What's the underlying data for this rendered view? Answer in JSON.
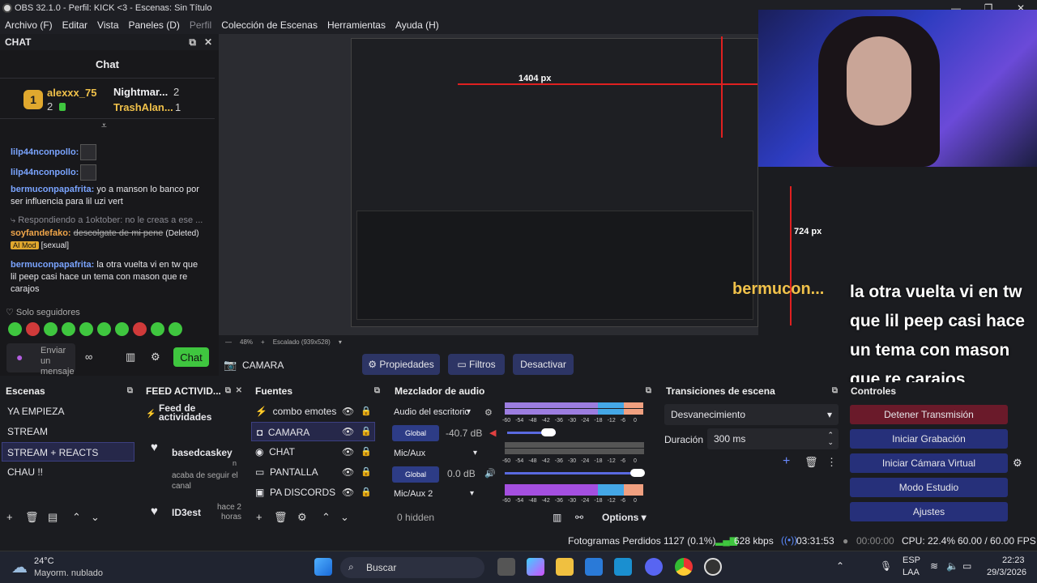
{
  "window": {
    "title": "OBS 32.1.0 - Perfil: KICK <3 - Escenas: Sin Título"
  },
  "menu": [
    "Archivo (F)",
    "Editar",
    "Vista",
    "Paneles (D)",
    "Perfil",
    "Colección de Escenas",
    "Herramientas",
    "Ayuda (H)"
  ],
  "chat": {
    "dock_title": "CHAT",
    "channel_title": "Chat",
    "leaders": [
      {
        "name": "alexxx_75",
        "rank": "1",
        "count": "2"
      },
      {
        "name": "Nightmar...",
        "count": "2"
      },
      {
        "name": "TrashAlan...",
        "count": "1"
      }
    ],
    "messages": [
      {
        "user": "lilp44nconpollo:",
        "text": ""
      },
      {
        "user": "lilp44nconpollo:",
        "text": ""
      },
      {
        "user": "bermuconpapafrita:",
        "text": "yo a manson lo banco por ser influencia para lil uzi vert"
      },
      {
        "reply": "Respondiendo a 1oktober: no le creas a ese ..."
      },
      {
        "user": "soyfandefako:",
        "text": "descolgate de mi pene",
        "deleted": "(Deleted)",
        "mod": "AI Mod",
        "flag": "[sexual]"
      },
      {
        "user": "bermuconpapafrita:",
        "text": "la otra vuelta vi en tw que lil peep casi hace un tema con mason que re carajos"
      }
    ],
    "followers_only": "Solo seguidores",
    "input_placeholder": "Enviar un mensaje",
    "send_label": "Chat"
  },
  "preview": {
    "nested_px_label": "1404 px",
    "nested_px_label2": "724 px",
    "overlay_user": "bermucon...",
    "overlay_text": "la otra vuelta vi en tw que lil peep casi hace un tema con mason que re carajos",
    "zoom": "48%",
    "scaling": "Escalado (939x528)"
  },
  "source_toolbar": {
    "source_name": "CAMARA",
    "properties": "Propiedades",
    "filters": "Filtros",
    "deactivate": "Desactivar"
  },
  "scenes": {
    "title": "Escenas",
    "items": [
      "YA EMPIEZA",
      "STREAM",
      "STREAM + REACTS",
      "CHAU !!"
    ],
    "selected": 2
  },
  "feed": {
    "title": "FEED ACTIVID...",
    "header": "Feed de actividades",
    "events": [
      {
        "user": "basedcaskey",
        "detail": "acaba de seguir el canal",
        "time": "n"
      },
      {
        "user": "ID3est",
        "detail": "",
        "time": "hace 2 horas"
      }
    ]
  },
  "sources": {
    "title": "Fuentes",
    "items": [
      "combo emotes",
      "CAMARA",
      "CHAT",
      "PANTALLA",
      "PA DISCORDS"
    ],
    "selected": 1
  },
  "mixer": {
    "title": "Mezclador de audio",
    "channels": [
      {
        "name": "Audio del escritorio",
        "global": "Global",
        "db": "-40.7 dB"
      },
      {
        "name": "Mic/Aux",
        "global": "Global",
        "db": "0.0 dB"
      },
      {
        "name": "Mic/Aux 2"
      }
    ],
    "ticks": [
      "-60",
      "-54",
      "-48",
      "-42",
      "-36",
      "-30",
      "-24",
      "-18",
      "-12",
      "-6",
      "0"
    ],
    "hidden": "0 hidden",
    "options": "Options"
  },
  "transitions": {
    "title": "Transiciones de escena",
    "selected": "Desvanecimiento",
    "duration_label": "Duración",
    "duration": "300 ms"
  },
  "controls": {
    "title": "Controles",
    "buttons": [
      "Detener Transmisión",
      "Iniciar Grabación",
      "Iniciar Cámara Virtual",
      "Modo Estudio",
      "Ajustes"
    ]
  },
  "status": {
    "dropped": "Fotogramas Perdidos 1127 (0.1%)",
    "kbps": "628 kbps",
    "live": "03:31:53",
    "rec": "00:00:00",
    "cpu": "CPU: 22.4%",
    "fps": "60.00 / 60.00 FPS"
  },
  "taskbar": {
    "temp": "24°C",
    "weather": "Mayorm. nublado",
    "search": "Buscar",
    "lang1": "ESP",
    "lang2": "LAA",
    "time": "22:23",
    "date": "29/3/2026"
  }
}
